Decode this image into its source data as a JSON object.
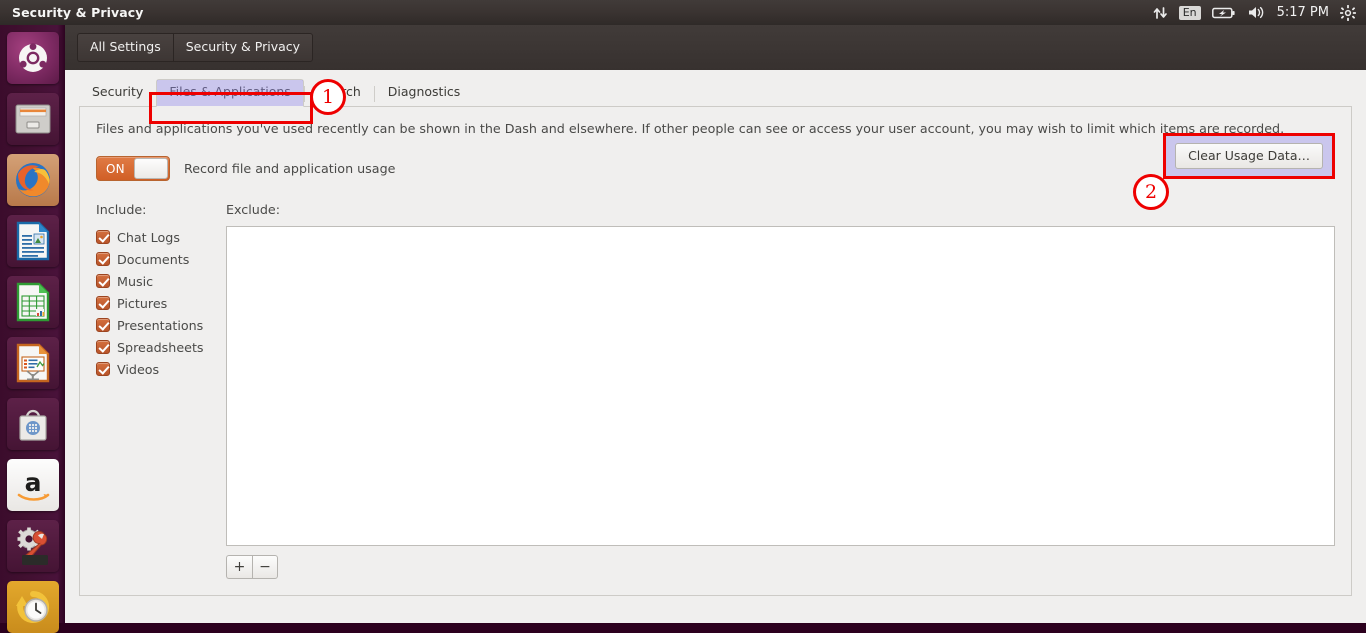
{
  "panel": {
    "title": "Security & Privacy",
    "tray": {
      "network_icon": "network-updown-icon",
      "keyboard_layout": "En",
      "battery_icon": "battery-charging-icon",
      "volume_icon": "volume-icon",
      "clock": "5:17 PM",
      "settings_icon": "gear-icon"
    }
  },
  "launcher": {
    "items": [
      {
        "name": "ubuntu-dash",
        "label": "Ubuntu Dash"
      },
      {
        "name": "files",
        "label": "Files"
      },
      {
        "name": "firefox",
        "label": "Firefox Web Browser"
      },
      {
        "name": "libreoffice-writer",
        "label": "LibreOffice Writer"
      },
      {
        "name": "libreoffice-calc",
        "label": "LibreOffice Calc"
      },
      {
        "name": "libreoffice-impress",
        "label": "LibreOffice Impress"
      },
      {
        "name": "software-center",
        "label": "Ubuntu Software Center"
      },
      {
        "name": "amazon",
        "label": "Amazon"
      },
      {
        "name": "system-settings",
        "label": "System Settings"
      },
      {
        "name": "backups",
        "label": "Backups"
      }
    ]
  },
  "toolbar": {
    "all_settings_label": "All Settings",
    "panel_name_label": "Security & Privacy"
  },
  "tabs": [
    {
      "label": "Security",
      "selected": false
    },
    {
      "label": "Files & Applications",
      "selected": true
    },
    {
      "label": "Search",
      "selected": false
    },
    {
      "label": "Diagnostics",
      "selected": false
    }
  ],
  "content": {
    "description": "Files and applications you've used recently can be shown in the Dash and elsewhere. If other people can see or access your user account, you may wish to limit which items are recorded.",
    "toggle": {
      "state_label": "ON",
      "caption": "Record file and application usage",
      "on": true
    },
    "clear_button_label": "Clear Usage Data…",
    "include_header": "Include:",
    "exclude_header": "Exclude:",
    "include_items": [
      {
        "label": "Chat Logs",
        "checked": true
      },
      {
        "label": "Documents",
        "checked": true
      },
      {
        "label": "Music",
        "checked": true
      },
      {
        "label": "Pictures",
        "checked": true
      },
      {
        "label": "Presentations",
        "checked": true
      },
      {
        "label": "Spreadsheets",
        "checked": true
      },
      {
        "label": "Videos",
        "checked": true
      }
    ],
    "exclude_items": [],
    "add_button_label": "+",
    "remove_button_label": "−"
  },
  "annotations": [
    {
      "number": "1",
      "target": "Files & Applications tab"
    },
    {
      "number": "2",
      "target": "Clear Usage Data… button"
    }
  ],
  "colors": {
    "accent_orange": "#d15f26",
    "annotation_red": "#ee0000",
    "highlight_purple": "#968cebd6",
    "panel_dark": "#3a3331",
    "launcher_purple": "#411030"
  }
}
